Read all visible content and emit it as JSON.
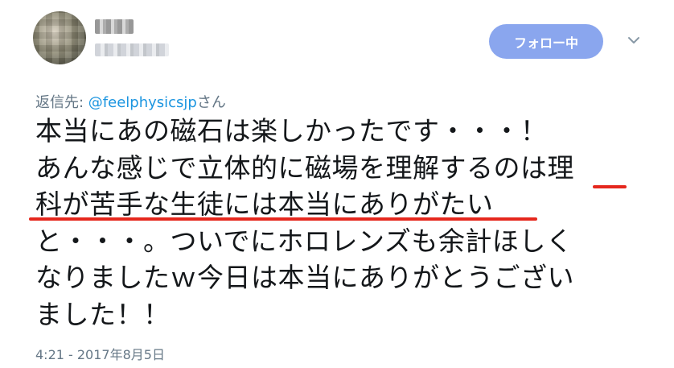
{
  "user": {
    "avatar_icon": "avatar-icon",
    "name": "名前",
    "handle": "@handle"
  },
  "follow_button": {
    "label": "フォロー中"
  },
  "menu": {
    "icon": "chevron-down-icon"
  },
  "reply": {
    "prefix": "返信先: ",
    "handle": "@feelphysicsjp",
    "suffix": "さん"
  },
  "tweet": {
    "lines": [
      "本当にあの磁石は楽しかったです・・・！",
      "あんな感じで立体的に磁場を理解するのは理",
      "科が苦手な生徒には本当にありがたい",
      "と・・・。ついでにホロレンズも余計ほしく",
      "なりましたｗ今日は本当にありがとうござい",
      "ました！！"
    ]
  },
  "timestamp": "4:21 - 2017年8月5日",
  "colors": {
    "accent": "#8aa6ee",
    "link": "#1b95e0",
    "underline": "#e5271d",
    "muted": "#657786",
    "text": "#14171a"
  }
}
